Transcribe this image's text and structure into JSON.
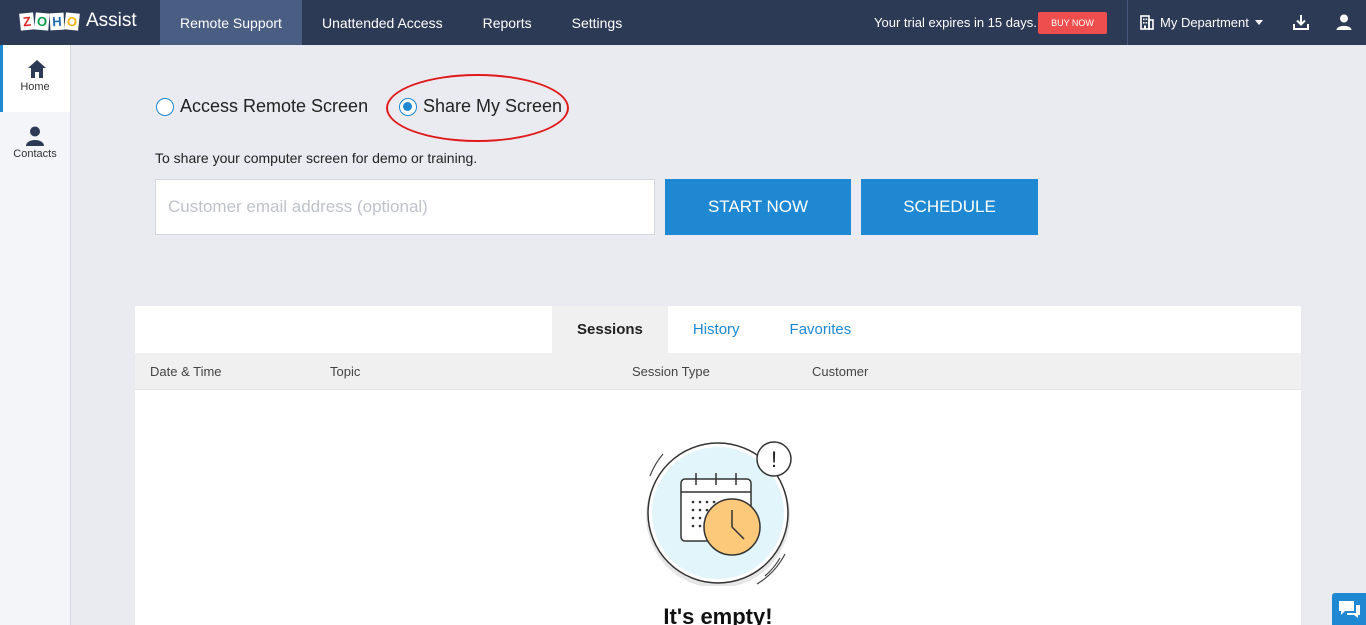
{
  "app": {
    "logo_text": "ZOHO",
    "logo_letters": [
      "Z",
      "O",
      "H",
      "O"
    ],
    "name": "Assist"
  },
  "nav": {
    "items": [
      {
        "label": "Remote Support",
        "active": true
      },
      {
        "label": "Unattended Access",
        "active": false
      },
      {
        "label": "Reports",
        "active": false
      },
      {
        "label": "Settings",
        "active": false
      }
    ]
  },
  "header": {
    "trial_text": "Your trial expires in 15 days.",
    "buy_now": "BUY NOW",
    "department": "My Department",
    "icons": [
      "building-icon",
      "download-icon",
      "user-icon"
    ]
  },
  "sidebar": {
    "items": [
      {
        "label": "Home",
        "icon": "home-icon",
        "active": true
      },
      {
        "label": "Contacts",
        "icon": "contacts-icon",
        "active": false
      }
    ]
  },
  "mode": {
    "options": [
      {
        "label": "Access Remote Screen",
        "selected": false
      },
      {
        "label": "Share My Screen",
        "selected": true
      }
    ],
    "description": "To share your computer screen for demo or training.",
    "email_placeholder": "Customer email address (optional)",
    "email_value": "",
    "start_now": "START NOW",
    "schedule": "SCHEDULE"
  },
  "sessions": {
    "tabs": [
      {
        "label": "Sessions",
        "active": true
      },
      {
        "label": "History",
        "active": false
      },
      {
        "label": "Favorites",
        "active": false
      }
    ],
    "columns": [
      "Date & Time",
      "Topic",
      "Session Type",
      "Customer"
    ],
    "rows": [],
    "empty_text": "It's empty!",
    "empty_badge": "!"
  },
  "colors": {
    "topbar": "#2c3a56",
    "accent": "#1e88d3",
    "buy_now": "#ef4e4e",
    "highlight": "#e01a1a"
  }
}
